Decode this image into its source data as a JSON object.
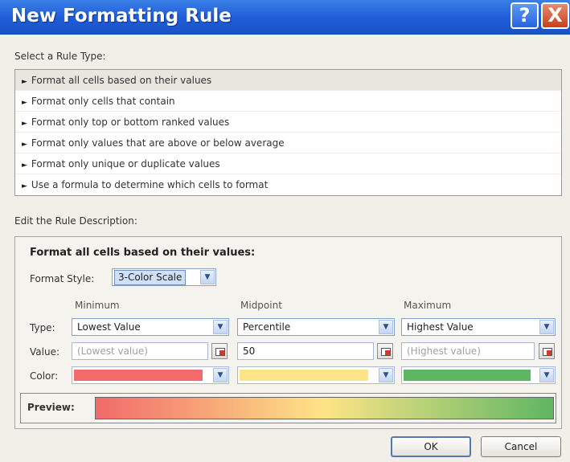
{
  "window": {
    "title": "New Formatting Rule",
    "help_glyph": "?",
    "close_glyph": "X"
  },
  "rule_type": {
    "label": "Select a Rule Type:",
    "items": [
      "Format all cells based on their values",
      "Format only cells that contain",
      "Format only top or bottom ranked values",
      "Format only values that are above or below average",
      "Format only unique or duplicate values",
      "Use a formula to determine which cells to format"
    ],
    "selected_index": 0
  },
  "edit": {
    "label": "Edit the Rule Description:",
    "heading": "Format all cells based on their values:",
    "format_style_label": "Format Style:",
    "format_style_value": "3-Color Scale",
    "columns": [
      "Minimum",
      "Midpoint",
      "Maximum"
    ],
    "row_labels": {
      "type": "Type:",
      "value": "Value:",
      "color": "Color:"
    },
    "types": [
      "Lowest Value",
      "Percentile",
      "Highest Value"
    ],
    "values": [
      "(Lowest value)",
      "50",
      "(Highest value)"
    ],
    "colors": [
      "#f26a6a",
      "#fde587",
      "#5fb662"
    ],
    "preview_label": "Preview:"
  },
  "buttons": {
    "ok": "OK",
    "cancel": "Cancel"
  }
}
